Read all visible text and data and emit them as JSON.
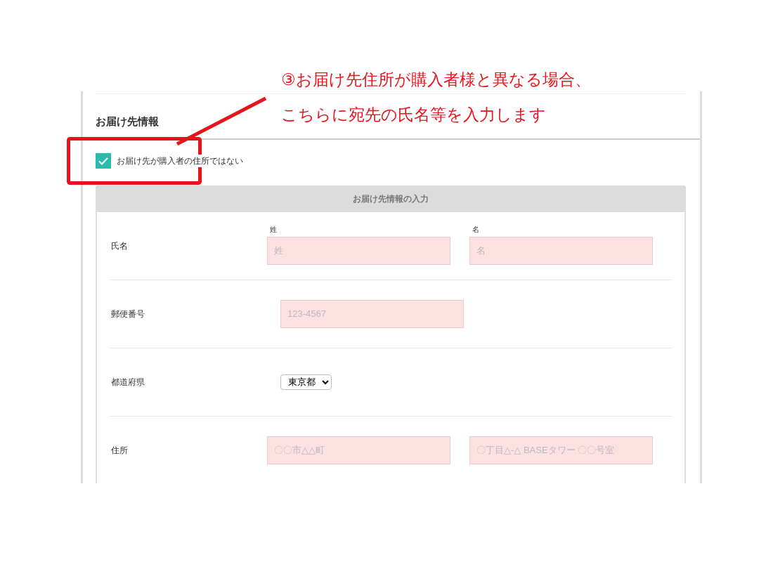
{
  "annotation": {
    "lines": [
      "③お届け先住所が購入者様と異なる場合、",
      "こちらに宛先の氏名等を入力します"
    ]
  },
  "section": {
    "title": "お届け先情報",
    "checkbox": {
      "label": "お届け先が購入者の住所ではない",
      "checked": true
    },
    "panel": {
      "title": "お届け先情報の入力",
      "rows": [
        {
          "label": "氏名",
          "kind": "inputs",
          "fields": [
            {
              "caption": "姓",
              "placeholder": "姓"
            },
            {
              "caption": "名",
              "placeholder": "名"
            }
          ]
        },
        {
          "label": "郵便番号",
          "kind": "inputs",
          "fields": [
            {
              "placeholder": "123-4567"
            }
          ]
        },
        {
          "label": "都道府県",
          "kind": "select",
          "value": "東京都"
        },
        {
          "label": "住所",
          "kind": "inputs",
          "fields": [
            {
              "placeholder": "〇〇市△△町"
            },
            {
              "placeholder": "〇丁目△-△ BASEタワー 〇〇号室"
            }
          ]
        }
      ]
    }
  }
}
